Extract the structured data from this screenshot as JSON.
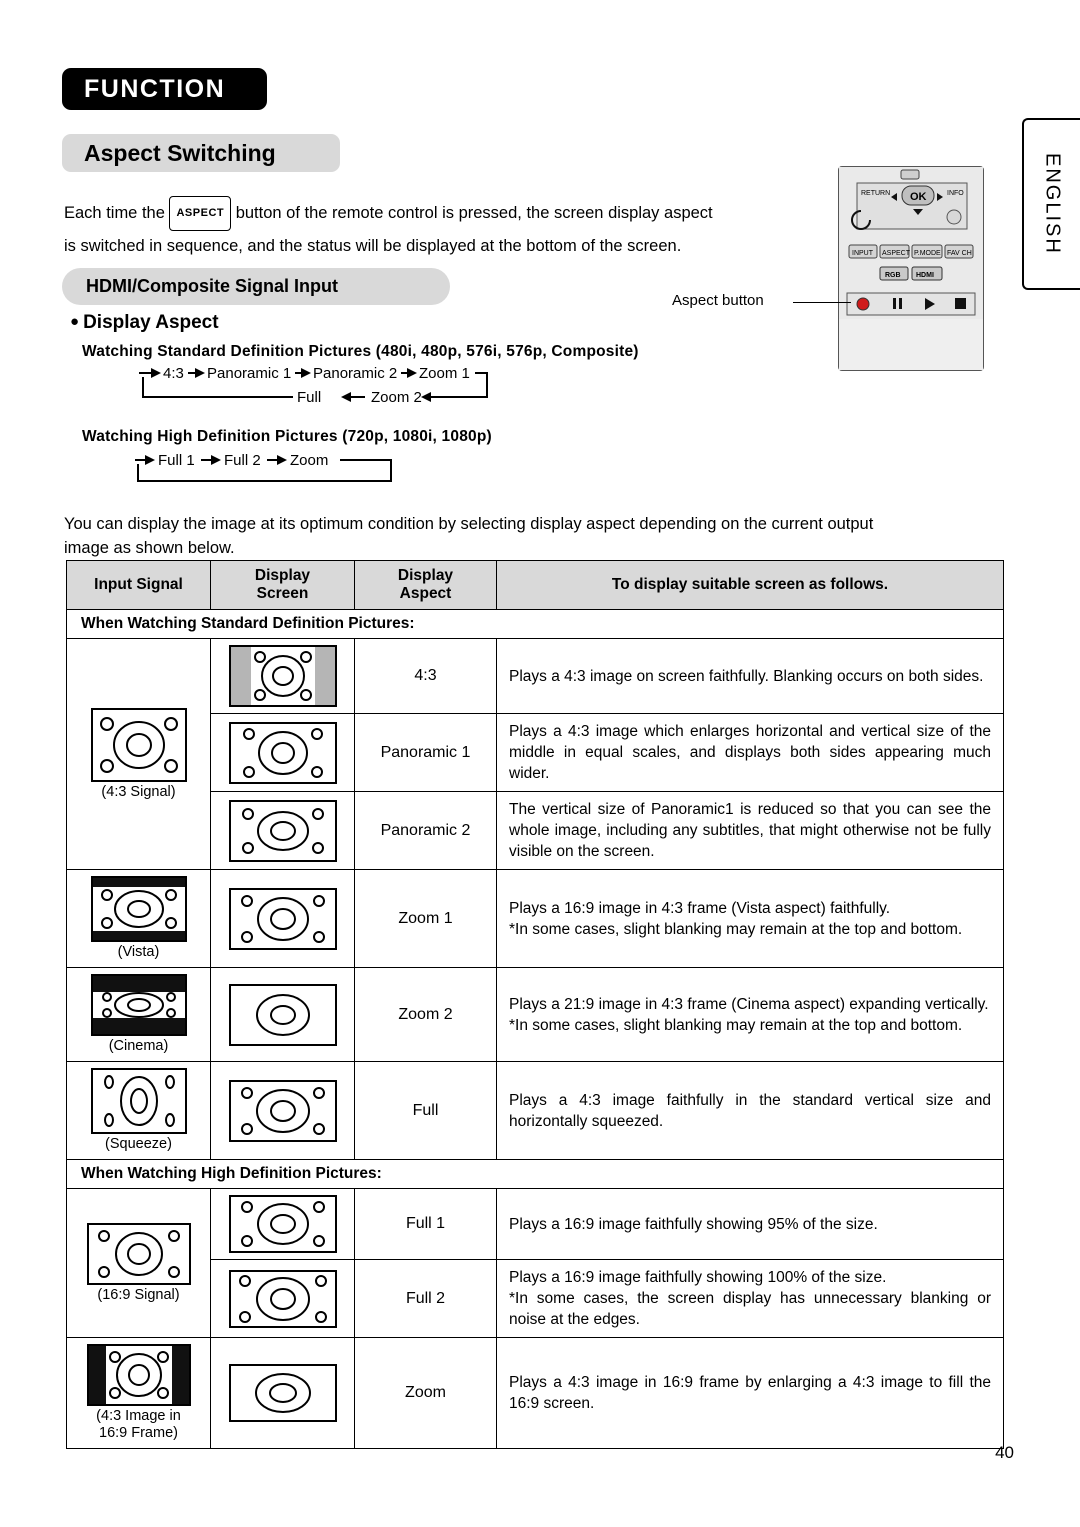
{
  "header": {
    "function_tab": "FUNCTION",
    "aspect_title": "Aspect Switching",
    "english_tab": "ENGLISH"
  },
  "intro": {
    "text_before_key": "Each time the",
    "key_label": "ASPECT",
    "text_after_key": "button of the remote control is pressed, the screen display aspect",
    "line2": "is switched in sequence, and the status will be displayed at the bottom of the screen."
  },
  "remote": {
    "callout": "Aspect button",
    "buttons": [
      "RETURN",
      "OK",
      "INFO",
      "INPUT",
      "ASPECT",
      "P.MODE",
      "FAV CH",
      "RGB",
      "HDMI"
    ]
  },
  "sections": {
    "hdmi_bar": "HDMI/Composite Signal Input",
    "display_aspect": "Display Aspect",
    "sd_head": "Watching Standard Definition Pictures (480i, 480p, 576i, 576p, Composite)",
    "hd_head": "Watching High Definition Pictures (720p, 1080i, 1080p)"
  },
  "flow_sd": {
    "top": [
      "4:3",
      "Panoramic 1",
      "Panoramic 2",
      "Zoom 1"
    ],
    "bottom": [
      "Full",
      "Zoom 2"
    ]
  },
  "flow_hd": {
    "items": [
      "Full 1",
      "Full 2",
      "Zoom"
    ]
  },
  "body_para": {
    "line1": "You can display the image at its optimum condition by selecting display aspect depending on the current output",
    "line2": "image as shown below."
  },
  "table": {
    "headers": {
      "input_signal": "Input Signal",
      "display_screen_l1": "Display",
      "display_screen_l2": "Screen",
      "display_aspect_l1": "Display",
      "display_aspect_l2": "Aspect",
      "description": "To display suitable screen as follows."
    },
    "section_sd": "When Watching Standard Definition Pictures:",
    "section_hd": "When Watching High Definition Pictures:",
    "signals": {
      "sd_43": "(4:3 Signal)",
      "vista": "(Vista)",
      "cinema": "(Cinema)",
      "squeeze": "(Squeeze)",
      "hd_169": "(16:9 Signal)",
      "hd_43_l1": "(4:3 Image in",
      "hd_43_l2": "16:9 Frame)"
    },
    "rows_sd": [
      {
        "aspect": "4:3",
        "desc": "Plays a 4:3 image on screen faithfully. Blanking occurs on both sides."
      },
      {
        "aspect": "Panoramic 1",
        "desc": "Plays a 4:3 image which enlarges horizontal and vertical size of the middle in equal scales, and displays both sides appearing much wider."
      },
      {
        "aspect": "Panoramic 2",
        "desc": "The vertical size of Panoramic1 is reduced so that you can see the whole image, including any subtitles, that might otherwise not be fully visible on the screen."
      },
      {
        "aspect": "Zoom 1",
        "desc": "Plays a 16:9 image in 4:3 frame (Vista aspect) faithfully.",
        "desc2": "*In some cases, slight blanking may remain at the top and bottom."
      },
      {
        "aspect": "Zoom 2",
        "desc": "Plays a 21:9 image in 4:3 frame (Cinema aspect) expanding vertically.",
        "desc2": "*In some cases, slight blanking may remain at the top and bottom."
      },
      {
        "aspect": "Full",
        "desc": "Plays a 4:3 image faithfully in the standard vertical size and horizontally squeezed."
      }
    ],
    "rows_hd": [
      {
        "aspect": "Full 1",
        "desc": "Plays a 16:9 image faithfully showing 95% of the size."
      },
      {
        "aspect": "Full 2",
        "desc": "Plays a 16:9 image faithfully showing 100% of the size.",
        "desc2": "*In some cases, the screen display has unnecessary blanking or noise at the edges."
      },
      {
        "aspect": "Zoom",
        "desc": "Plays a 4:3 image in 16:9 frame by enlarging a 4:3 image to fill the 16:9 screen."
      }
    ]
  },
  "page_number": "40"
}
